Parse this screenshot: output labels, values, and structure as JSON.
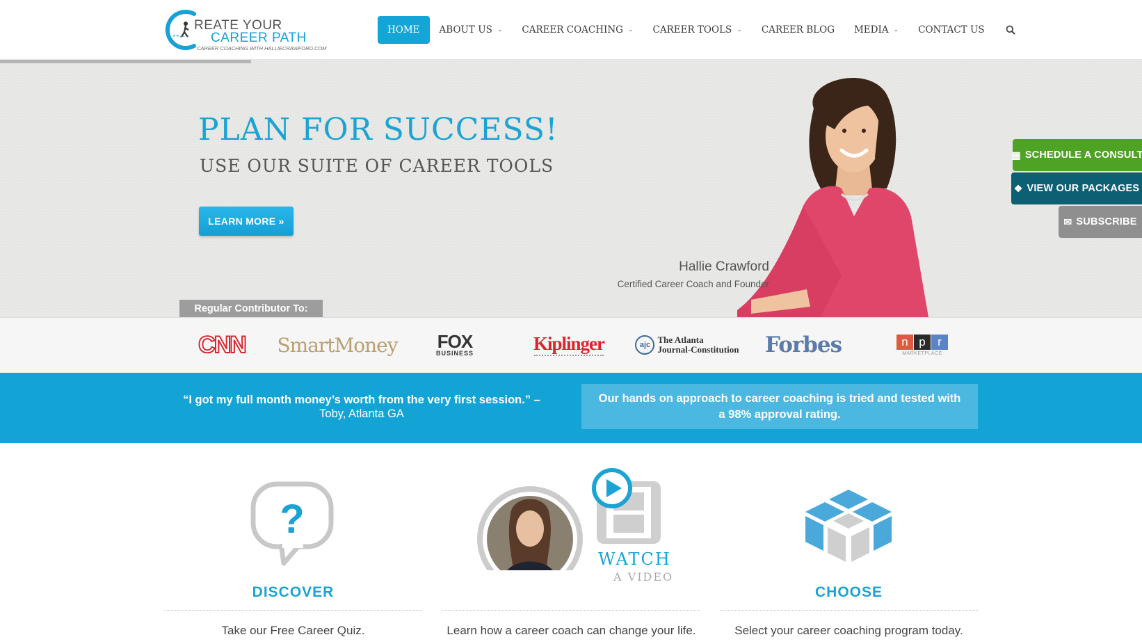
{
  "brand": {
    "line1": "REATE YOUR",
    "line2": "CAREER PATH",
    "tagline": "CAREER COACHING WITH HALLIECRAWFORD.COM"
  },
  "nav": {
    "items": [
      {
        "label": "HOME",
        "active": true,
        "dropdown": false
      },
      {
        "label": "ABOUT US",
        "dropdown": true
      },
      {
        "label": "CAREER COACHING",
        "dropdown": true
      },
      {
        "label": "CAREER TOOLS",
        "dropdown": true
      },
      {
        "label": "CAREER BLOG",
        "dropdown": false
      },
      {
        "label": "MEDIA",
        "dropdown": true
      },
      {
        "label": "CONTACT US",
        "dropdown": false
      }
    ],
    "search_icon": "search-icon"
  },
  "hero": {
    "title": "PLAN FOR SUCCESS!",
    "subtitle": "USE OUR SUITE OF CAREER TOOLS",
    "cta_label": "LEARN MORE »",
    "person_name": "Hallie Crawford",
    "person_role": "Certified Career Coach and Founder",
    "slider_progress": 0.22
  },
  "side_buttons": {
    "schedule": "SCHEDULE A CONSULT",
    "packages": "VIEW OUR PACKAGES",
    "subscribe": "SUBSCRIBE"
  },
  "contributor": {
    "label": "Regular Contributor To:",
    "logos": {
      "cnn": "CNN",
      "smartmoney": "SmartMoney",
      "fox1": "FOX",
      "fox2": "BUSINESS",
      "kiplinger": "Kiplinger",
      "ajc_badge": "ajc",
      "ajc1": "The Atlanta",
      "ajc2": "Journal-Constitution",
      "forbes": "Forbes",
      "npr_n": "n",
      "npr_p": "p",
      "npr_r": "r",
      "npr_sub": "MARKETPLACE"
    }
  },
  "band": {
    "quote": "“I got my full month money’s worth from the very first session.” –",
    "quote_author": "Toby, Atlanta GA",
    "approval": "Our hands on approach to career coaching is tried and tested with a 98% approval rating."
  },
  "features": {
    "discover": {
      "title": "DISCOVER",
      "desc": "Take our Free Career Quiz."
    },
    "watch": {
      "title1": "WATCH",
      "title2": "A VIDEO",
      "desc": "Learn how a career coach can change your life."
    },
    "choose": {
      "title": "CHOOSE",
      "desc": "Select your career coaching program today."
    }
  },
  "colors": {
    "accent": "#13a3d5",
    "green": "#4fa324",
    "teal_dark": "#0d5f73",
    "gray_btn": "#8f8f8f"
  }
}
